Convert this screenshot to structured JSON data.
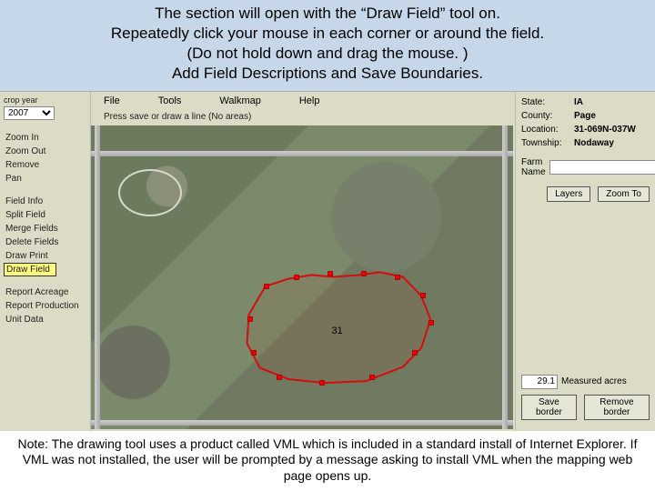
{
  "banner": {
    "line1": "The section will open with the “Draw Field” tool on.",
    "line2": "Repeatedly click your mouse in each corner or around the field.",
    "line3": "(Do not hold down and drag the mouse. )",
    "line4": "Add Field Descriptions and Save Boundaries."
  },
  "left": {
    "crop_year_label": "crop year",
    "crop_year_value": "2007",
    "tools": {
      "zoom_in": "Zoom In",
      "zoom_out": "Zoom Out",
      "remove": "Remove",
      "pan": "Pan",
      "field_info": "Field Info",
      "split_field": "Split Field",
      "merge_fields": "Merge Fields",
      "delete_fields": "Delete Fields",
      "draw_print": "Draw Print",
      "draw_field": "Draw Field",
      "report_acreage": "Report Acreage",
      "report_production": "Report Production",
      "unit_data": "Unit Data"
    }
  },
  "menubar": {
    "file": "File",
    "tools": "Tools",
    "walkmap": "Walkmap",
    "help": "Help"
  },
  "hint": "Press save or draw a line (No areas)",
  "map": {
    "field_label": "31"
  },
  "right": {
    "state_k": "State:",
    "state_v": "IA",
    "county_k": "County:",
    "county_v": "Page",
    "location_k": "Location:",
    "location_v": "31-069N-037W",
    "township_k": "Township:",
    "township_v": "Nodaway",
    "farm_name_k": "Farm Name",
    "farm_name_v": "",
    "layers_btn": "Layers",
    "zoom_to_btn": "Zoom To",
    "acres_value": "29.1",
    "acres_label": "Measured acres",
    "save_border_btn": "Save border",
    "remove_border_btn": "Remove border"
  },
  "footer": {
    "text": "Note: The drawing tool uses a product called VML which is included in a standard install of Internet Explorer. If VML was not installed, the user will be prompted by a message asking to install VML when the mapping web page opens up."
  }
}
